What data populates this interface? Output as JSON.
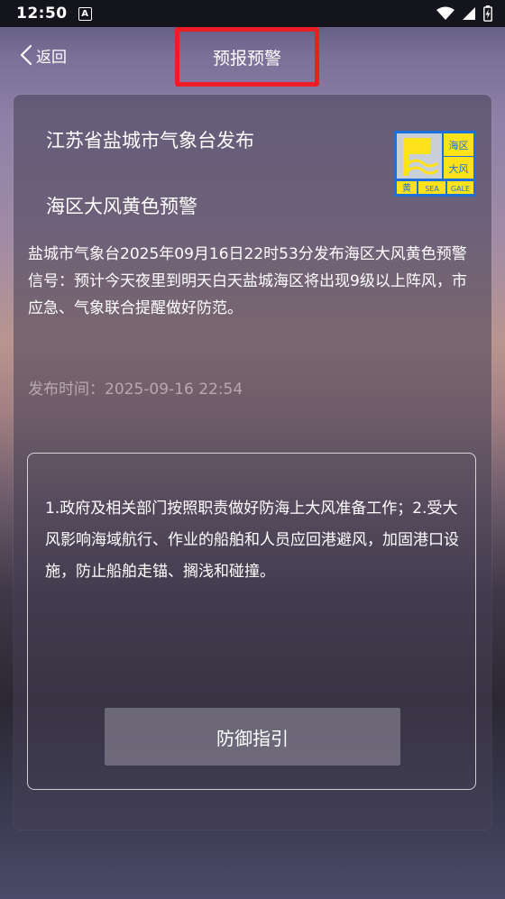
{
  "status_bar": {
    "time": "12:50",
    "notification_badge": "A"
  },
  "nav": {
    "back_label": "返回",
    "title": "预报预警"
  },
  "warning": {
    "issuer": "江苏省盐城市气象台发布",
    "name": "海区大风黄色预警",
    "icon_text": {
      "top_right": "海区\n大风",
      "level": "黄",
      "sea": "SEA",
      "gale": "GALE"
    },
    "body": "盐城市气象台2025年09月16日22时53分发布海区大风黄色预警信号：预计今天夜里到明天白天盐城海区将出现9级以上阵风，市应急、气象联合提醒做好防范。",
    "publish_time_label": "发布时间：",
    "publish_time": "2025-09-16 22:54"
  },
  "guide": {
    "text": "1.政府及相关部门按照职责做好防海上大风准备工作；2.受大风影响海域航行、作业的船舶和人员应回港避风，加固港口设施，防止船舶走锚、搁浅和碰撞。",
    "button_label": "防御指引"
  },
  "colors": {
    "highlight_border": "#ee1c25",
    "icon_blue": "#1e6fd9",
    "icon_yellow": "#ffe21a"
  }
}
